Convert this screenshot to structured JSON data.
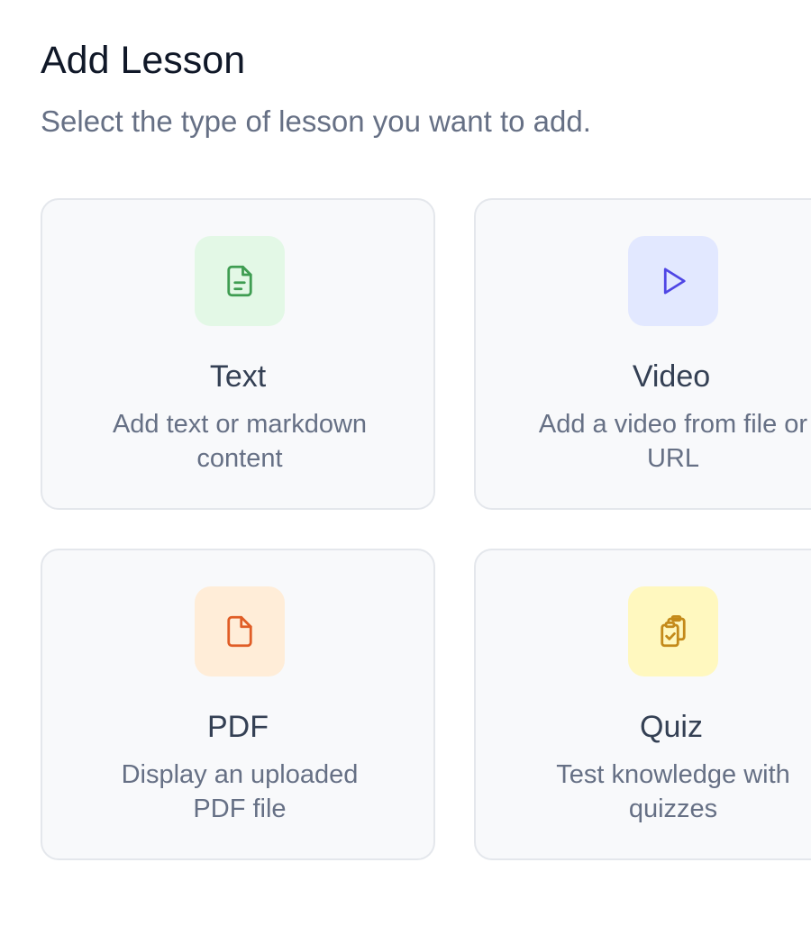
{
  "dialog": {
    "title": "Add Lesson",
    "subtitle": "Select the type of lesson you want to add."
  },
  "lesson_types": [
    {
      "title": "Text",
      "desc_line1": "Add text or markdown",
      "desc_line2": "content",
      "icon": "file-text-icon",
      "icon_color": "#3f9d52",
      "icon_bg": "#e3f8e6"
    },
    {
      "title": "Video",
      "desc_line1": "Add a video from file or",
      "desc_line2": "URL",
      "icon": "play-icon",
      "icon_color": "#4f46e5",
      "icon_bg": "#e2e8ff"
    },
    {
      "title": "PDF",
      "desc_line1": "Display an uploaded",
      "desc_line2": "PDF file",
      "icon": "file-icon",
      "icon_color": "#e05d26",
      "icon_bg": "#ffedd8"
    },
    {
      "title": "Quiz",
      "desc_line1": "Test knowledge with",
      "desc_line2": "quizzes",
      "icon": "clipboard-check-icon",
      "icon_color": "#c48a1a",
      "icon_bg": "#fff8bf"
    }
  ]
}
